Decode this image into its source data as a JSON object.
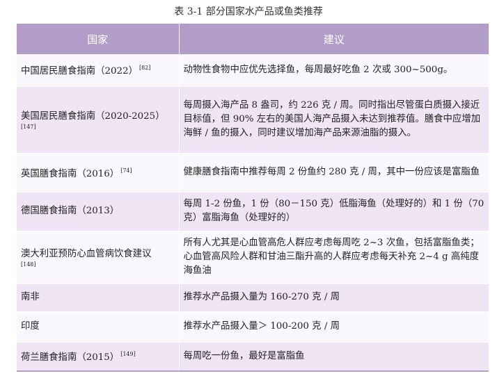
{
  "caption": "表 3-1  部分国家水产品或鱼类推荐",
  "table": {
    "headers": [
      "国家",
      "建议"
    ],
    "rows": [
      {
        "country": "中国居民膳食指南（2022）",
        "ref": "[82]",
        "advice": "动物性食物中应优先选择鱼，每周最好吃鱼 2 次或 300~500g。"
      },
      {
        "country": "美国居民膳食指南（2020-2025）",
        "ref": "[147]",
        "advice": "每周摄入海产品 8 盎司，约 226 克 / 周。同时指出尽管蛋白质摄入接近目标值，但 90% 左右的美国人海产品摄入未达到推荐值。膳食中应增加海鲜 / 鱼的摄入，同时建议增加海产品来源油脂的摄入。"
      },
      {
        "country": "英国膳食指南（2016）",
        "ref": "[74]",
        "advice": "健康膳食指南中推荐每周 2 份鱼约 280 克 / 周，其中一份应该是富脂鱼"
      },
      {
        "country": "德国膳食指南（2013）",
        "ref": "",
        "advice": "每周 1-2 份鱼，1 份（80－150 克）低脂海鱼（处理好的）和 1 份（70 克）富脂海鱼（处理好的）"
      },
      {
        "country": "澳大利亚预防心血管病饮食建议",
        "ref": "[148]",
        "advice": "所有人尤其是心血管高危人群应考虑每周吃 2~3 次鱼，包括富脂鱼类；心血管高风险人群和甘油三酯升高的人群应考虑每天补充 2~4 g 高纯度海鱼油"
      },
      {
        "country": "南非",
        "ref": "",
        "advice": "推荐水产品摄入量为 160-270 克 / 周"
      },
      {
        "country": "印度",
        "ref": "",
        "advice": "推荐水产品摄入量＞ 100-200 克 / 周"
      },
      {
        "country": "荷兰膳食指南（2015）",
        "ref": "[149]",
        "advice": "每周吃一份鱼，最好是富脂鱼"
      }
    ]
  }
}
